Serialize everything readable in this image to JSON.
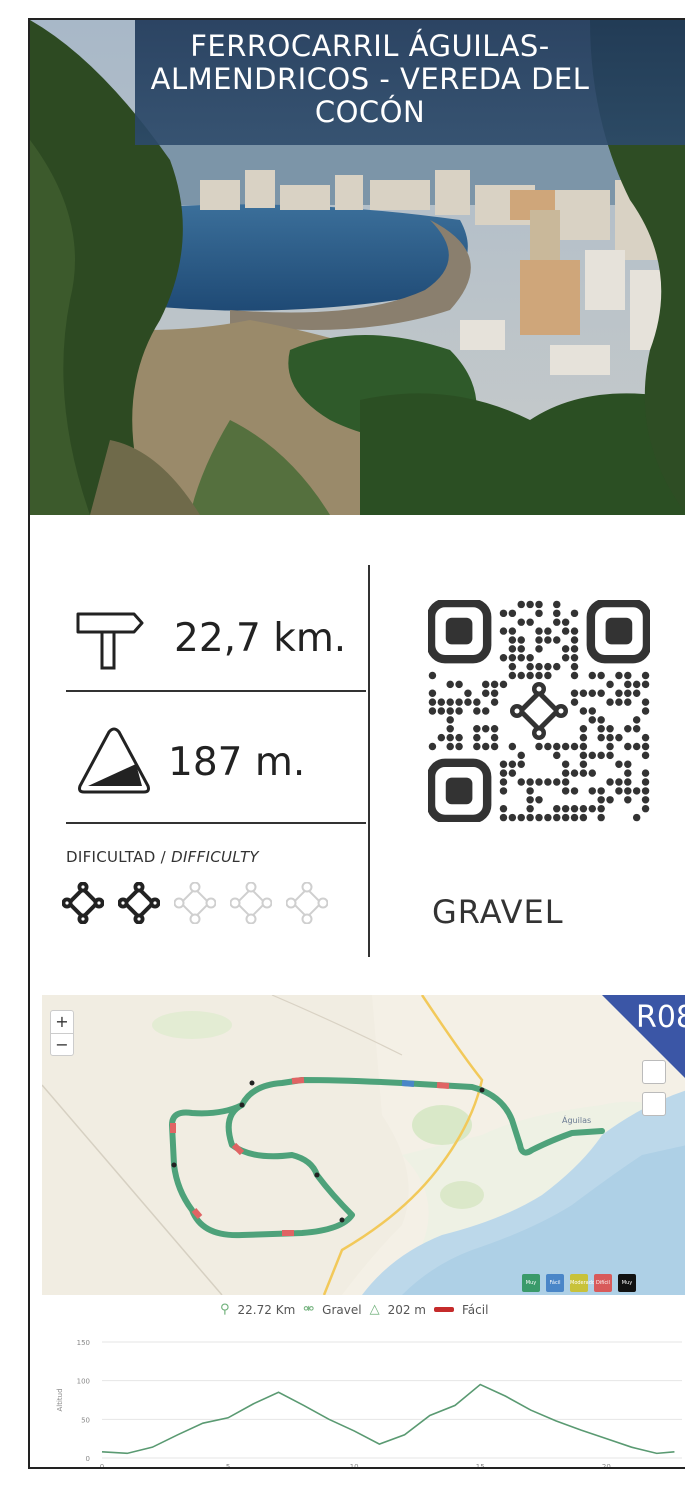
{
  "route": {
    "title": "FERROCARRIL ÁGUILAS-\nALMENDRICOS - VEREDA DEL\nCOCÓN",
    "title_lines": [
      "FERROCARRIL ÁGUILAS-",
      "ALMENDRICOS - VEREDA DEL",
      "COCÓN"
    ],
    "distance": "22,7 km.",
    "elevation": "187 m.",
    "difficulty_label": "DIFICULTAD /",
    "difficulty_label_en": "DIFFICULTY",
    "difficulty_level": 2,
    "difficulty_max": 5,
    "category": "GRAVEL",
    "code": "R08"
  },
  "icons": {
    "distance": "signpost-icon",
    "elevation": "slope-icon",
    "difficulty": "bike-chain-icon",
    "qr": "qr-code-icon"
  },
  "map": {
    "place_label": "Águilas",
    "zoom_in": "+",
    "zoom_out": "−",
    "legend": [
      {
        "label": "Muy fácil",
        "color": "#3a9a6a"
      },
      {
        "label": "Fácil",
        "color": "#4a86c8"
      },
      {
        "label": "Moderado",
        "color": "#c8c23a"
      },
      {
        "label": "Difícil",
        "color": "#d85a5a"
      },
      {
        "label": "Muy difícil",
        "color": "#111111"
      }
    ],
    "route_color": "#4ea27a",
    "accent_color": "#3b56a6"
  },
  "summary": {
    "distance": "22.72 Km",
    "type": "Gravel",
    "elevation": "202 m",
    "difficulty": "Fácil"
  },
  "profile": {
    "ylabel": "Altitud",
    "yticks": [
      "150",
      "100",
      "50",
      "0"
    ],
    "xticks": [
      "0",
      "5",
      "10",
      "15",
      "20"
    ]
  },
  "chart_data": {
    "type": "area",
    "ylabel": "Altitud",
    "ylim": [
      0,
      150
    ],
    "xlim": [
      0,
      23
    ],
    "grid": true,
    "x": [
      0,
      1,
      2,
      3,
      4,
      5,
      6,
      7,
      8,
      9,
      10,
      11,
      12,
      13,
      14,
      15,
      16,
      17,
      18,
      19,
      20,
      21,
      22,
      22.7
    ],
    "y": [
      8,
      6,
      14,
      30,
      45,
      52,
      70,
      85,
      68,
      50,
      35,
      18,
      30,
      55,
      68,
      95,
      80,
      62,
      48,
      36,
      25,
      14,
      6,
      8
    ]
  }
}
